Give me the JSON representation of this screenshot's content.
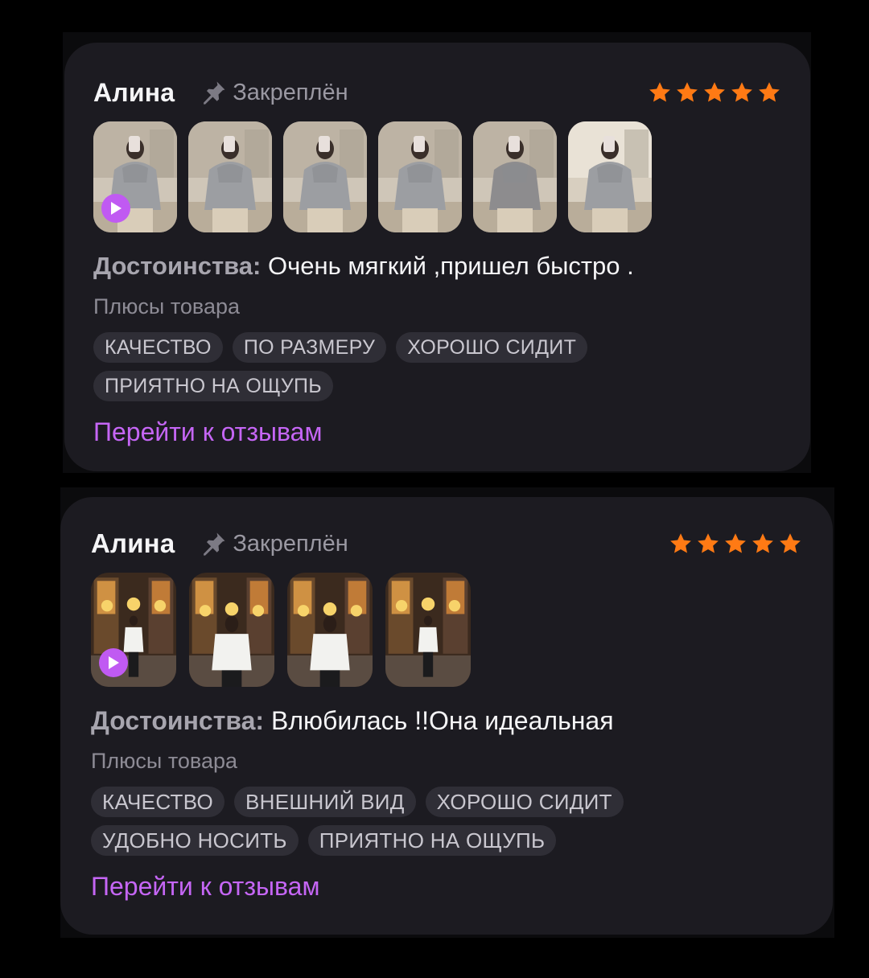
{
  "reviews": [
    {
      "author": "Алина",
      "pinned_label": "Закреплён",
      "rating": 5,
      "thumbnails": [
        {
          "kind": "video",
          "scene": "sweater-mirror"
        },
        {
          "kind": "photo",
          "scene": "sweater-mirror"
        },
        {
          "kind": "photo",
          "scene": "sweater-mirror"
        },
        {
          "kind": "photo",
          "scene": "sweater-mirror"
        },
        {
          "kind": "photo",
          "scene": "sweater-hood"
        },
        {
          "kind": "photo",
          "scene": "sweater-mirror-light"
        }
      ],
      "pros_key": "Достоинства:",
      "pros_text": " Очень мягкий ,пришел быстро .",
      "pros_subtitle": "Плюсы товара",
      "tags": [
        "КАЧЕСТВО",
        "ПО РАЗМЕРУ",
        "ХОРОШО СИДИТ",
        "ПРИЯТНО НА ОЩУПЬ"
      ],
      "link_label": "Перейти к отзывам"
    },
    {
      "author": "Алина",
      "pinned_label": "Закреплён",
      "rating": 5,
      "thumbnails": [
        {
          "kind": "video",
          "scene": "storefront-far"
        },
        {
          "kind": "photo",
          "scene": "storefront-close"
        },
        {
          "kind": "photo",
          "scene": "storefront-close"
        },
        {
          "kind": "photo",
          "scene": "storefront-far"
        }
      ],
      "pros_key": "Достоинства:",
      "pros_text": " Влюбилась !!Она идеальная",
      "pros_subtitle": "Плюсы товара",
      "tags": [
        "КАЧЕСТВО",
        "ВНЕШНИЙ ВИД",
        "ХОРОШО СИДИТ",
        "УДОБНО НОСИТЬ",
        "ПРИЯТНО НА ОЩУПЬ"
      ],
      "link_label": "Перейти к отзывам"
    }
  ],
  "colors": {
    "card_bg": "#1c1b21",
    "star": "#ff7a14",
    "accent_link": "#c566f5",
    "play_button": "#c05af2",
    "tag_bg": "#2f2e36"
  },
  "icons": {
    "pin": "pushpin-icon",
    "star": "star-icon",
    "play": "play-icon"
  }
}
